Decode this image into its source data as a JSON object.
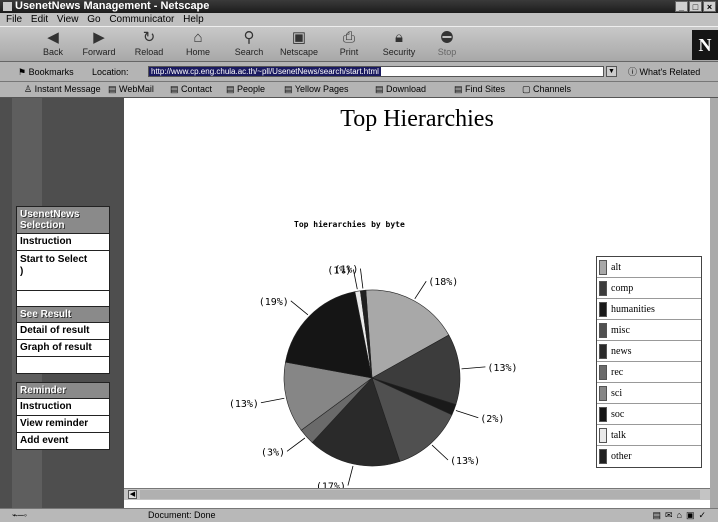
{
  "window": {
    "title": "UsenetNews Management - Netscape"
  },
  "menu": [
    "File",
    "Edit",
    "View",
    "Go",
    "Communicator",
    "Help"
  ],
  "toolbar": [
    {
      "label": "Back",
      "icon": "back-arrow-icon"
    },
    {
      "label": "Forward",
      "icon": "forward-arrow-icon"
    },
    {
      "label": "Reload",
      "icon": "reload-icon"
    },
    {
      "label": "Home",
      "icon": "home-icon"
    },
    {
      "label": "Search",
      "icon": "search-icon"
    },
    {
      "label": "Netscape",
      "icon": "netscape-icon"
    },
    {
      "label": "Print",
      "icon": "print-icon"
    },
    {
      "label": "Security",
      "icon": "security-icon"
    },
    {
      "label": "Stop",
      "icon": "stop-icon"
    }
  ],
  "location": {
    "bookmarks": "Bookmarks",
    "label": "Location:",
    "url": "http://www.cp.eng.chula.ac.th/~pll/UsenetNews/search/start.html",
    "related": "What's Related"
  },
  "personal_toolbar": [
    "Instant Message",
    "WebMail",
    "Contact",
    "People",
    "Yellow Pages",
    "Download",
    "Find Sites",
    "Channels"
  ],
  "sidebar": {
    "sections": [
      {
        "header": "UsenetNews Selection",
        "items": [
          "Instruction",
          "Start to Select"
        ]
      },
      {
        "header": "See Result",
        "items": [
          "Detail of result",
          "Graph of result"
        ]
      },
      {
        "header": "Reminder",
        "items": [
          "Instruction",
          "View reminder",
          "Add event"
        ]
      }
    ]
  },
  "page": {
    "title": "Top Hierarchies"
  },
  "chart_data": {
    "type": "pie",
    "title": "Top hierarchies by byte",
    "slices": [
      {
        "label": "alt",
        "percent_label": "(18%)",
        "value": 18,
        "color": "#a8a8a8"
      },
      {
        "label": "comp",
        "percent_label": "(13%)",
        "value": 13,
        "color": "#3c3c3c"
      },
      {
        "label": "humanities",
        "percent_label": "(2%)",
        "value": 2,
        "color": "#1a1a1a"
      },
      {
        "label": "misc",
        "percent_label": "(13%)",
        "value": 13,
        "color": "#505050"
      },
      {
        "label": "news",
        "percent_label": "(17%)",
        "value": 17,
        "color": "#2a2a2a"
      },
      {
        "label": "rec",
        "percent_label": "(3%)",
        "value": 3,
        "color": "#6a6a6a"
      },
      {
        "label": "sci",
        "percent_label": "(13%)",
        "value": 13,
        "color": "#868686"
      },
      {
        "label": "soc",
        "percent_label": "(19%)",
        "value": 19,
        "color": "#151515"
      },
      {
        "label": "talk",
        "percent_label": "(1%)",
        "value": 1,
        "color": "#eaeaea"
      },
      {
        "label": "other",
        "percent_label": "(1%)",
        "value": 1,
        "color": "#202020"
      }
    ],
    "legend": "right"
  },
  "status": {
    "text": "Document: Done"
  }
}
